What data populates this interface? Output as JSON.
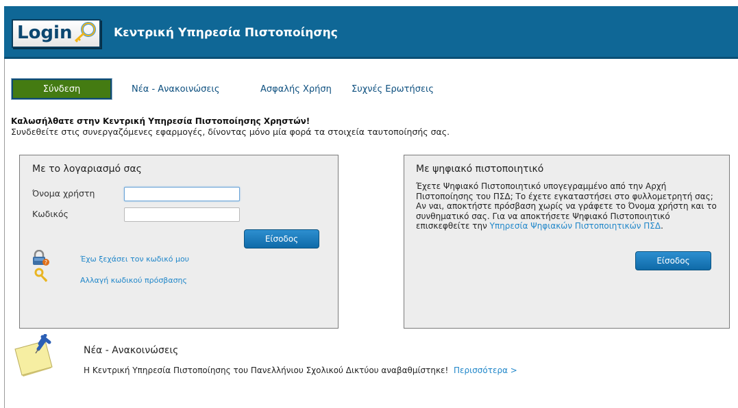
{
  "header": {
    "logo_text": "Login",
    "title": "Κεντρική Υπηρεσία Πιστοποίησης"
  },
  "nav": {
    "login": "Σύνδεση",
    "news": "Νέα - Ανακοινώσεις",
    "safe_use": "Ασφαλής Χρήση",
    "faq": "Συχνές Ερωτήσεις"
  },
  "welcome": {
    "title": "Καλωσήλθατε στην Κεντρική Υπηρεσία Πιστοποίησης Χρηστών!",
    "subtitle": "Συνδεθείτε στις συνεργαζόμενες εφαρμογές, δίνοντας μόνο μία φορά τα στοιχεία ταυτοποίησής σας."
  },
  "account_panel": {
    "title": "Με το λογαριασμό σας",
    "username_label": "Όνομα χρήστη",
    "username_value": "",
    "password_label": "Κωδικός",
    "password_value": "",
    "submit": "Είσοδος",
    "forgot_link": "Έχω ξεχάσει τον κωδικό μου",
    "change_link": "Αλλαγή κωδικού πρόσβασης"
  },
  "cert_panel": {
    "title": "Με ψηφιακό πιστοποιητικό",
    "text": "Έχετε Ψηφιακό Πιστοποιητικό υπογεγραμμένο από την Αρχή Πιστοποίησης του ΠΣΔ; Το έχετε εγκαταστήσει στο φυλλομετρητή σας; Αν ναι, αποκτήστε πρόσβαση χωρίς να γράφετε το Όνομα χρήστη και το συνθηματικό σας. Για να αποκτήσετε Ψηφιακό Πιστοποιητικό επισκεφθείτε την",
    "link": "Υπηρεσία Ψηφιακών Πιστοποιητικών ΠΣΔ",
    "text_end": ".",
    "submit": "Είσοδος"
  },
  "news": {
    "title": "Νέα - Ανακοινώσεις",
    "text": "Η Κεντρική Υπηρεσία Πιστοποίησης του Πανελλήνιου Σχολικού Δικτύου αναβαθμίστηκε!",
    "more": "Περισσότερα >"
  },
  "colors": {
    "header_bg": "#0f6796",
    "nav_active_bg": "#447b12",
    "link": "#1f86c9",
    "panel_bg": "#ededed"
  }
}
